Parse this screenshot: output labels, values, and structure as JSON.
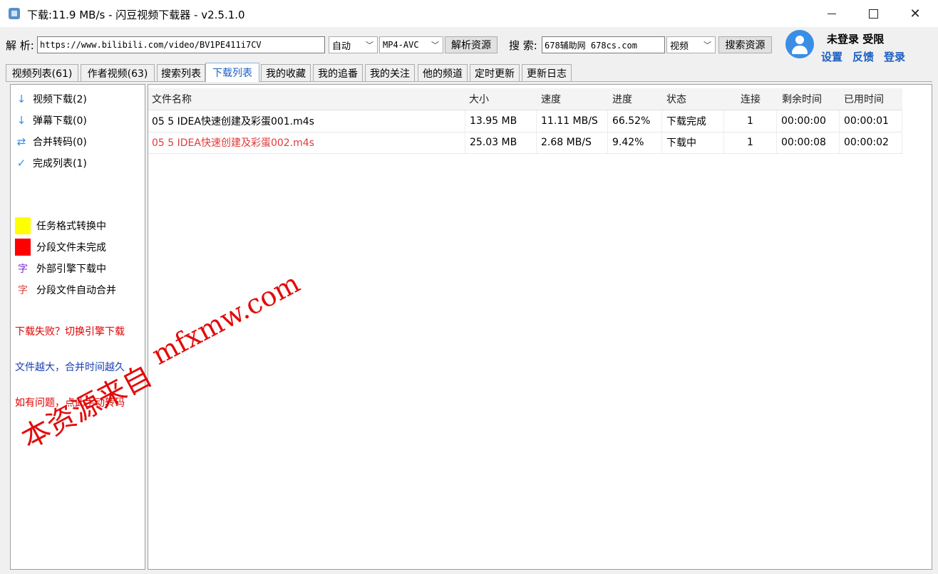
{
  "window": {
    "title": "下载:11.9 MB/s - 闪豆视频下载器 - v2.5.1.0",
    "minimize": "—",
    "maximize": "☐",
    "close": "✕"
  },
  "toolbar": {
    "parse_label": "解 析:",
    "url_value": "https://www.bilibili.com/video/BV1PE411i7CV",
    "quality_select": "自动",
    "format_select": "MP4-AVC",
    "parse_button": "解析资源",
    "search_label": "搜 索:",
    "search_value": "678辅助网 678cs.com",
    "search_type_select": "视频",
    "search_button": "搜索资源"
  },
  "user": {
    "status": "未登录 受限",
    "settings_link": "设置",
    "feedback_link": "反馈",
    "login_link": "登录"
  },
  "tabs": [
    {
      "label": "视频列表(61)"
    },
    {
      "label": "作者视频(63)"
    },
    {
      "label": "搜索列表"
    },
    {
      "label": "下载列表"
    },
    {
      "label": "我的收藏"
    },
    {
      "label": "我的追番"
    },
    {
      "label": "我的关注"
    },
    {
      "label": "他的频道"
    },
    {
      "label": "定时更新"
    },
    {
      "label": "更新日志"
    }
  ],
  "active_tab": "下载列表",
  "sidebar": {
    "items": [
      {
        "icon": "download-arrow-icon",
        "label": "视频下载(2)"
      },
      {
        "icon": "download-arrow-icon",
        "label": "弹幕下载(0)"
      },
      {
        "icon": "swap-arrows-icon",
        "label": "合并转码(0)"
      },
      {
        "icon": "check-icon",
        "label": "完成列表(1)"
      }
    ],
    "legend": [
      {
        "type": "swatch",
        "color": "#ffff00",
        "label": "任务格式转换中"
      },
      {
        "type": "swatch",
        "color": "#ff0000",
        "label": "分段文件未完成"
      },
      {
        "type": "glyph",
        "glyph": "字",
        "color": "#7b2bd1",
        "label": "外部引擎下载中"
      },
      {
        "type": "glyph",
        "glyph": "字",
        "color": "#e03a3a",
        "label": "分段文件自动合并"
      }
    ],
    "notes": [
      {
        "text": "下载失败？切换引擎下载",
        "color": "#e00000"
      },
      {
        "text": "文件越大，合并时间越久",
        "color": "#1a3fb0"
      },
      {
        "text": "如有问题，点此手动转码",
        "color": "#e00000"
      }
    ]
  },
  "table": {
    "columns": [
      "文件名称",
      "大小",
      "速度",
      "进度",
      "状态",
      "连接",
      "剩余时间",
      "已用时间"
    ],
    "rows": [
      {
        "name": "05 5 IDEA快速创建及彩蛋001.m4s",
        "size": "13.95 MB",
        "speed": "11.11 MB/S",
        "progress": "66.52%",
        "status": "下载完成",
        "connections": "1",
        "remaining": "00:00:00",
        "elapsed": "00:00:01",
        "highlight": false
      },
      {
        "name": "05 5 IDEA快速创建及彩蛋002.m4s",
        "size": "25.03 MB",
        "speed": "2.68 MB/S",
        "progress": "9.42%",
        "status": "下载中",
        "connections": "1",
        "remaining": "00:00:08",
        "elapsed": "00:00:02",
        "highlight": true
      }
    ]
  },
  "watermark": {
    "line1": "mfxmw.com",
    "line2": "本资源来自"
  },
  "colors": {
    "accent": "#1a5fc2",
    "avatar": "#3a8ee6",
    "error_text": "#e03a3a"
  }
}
